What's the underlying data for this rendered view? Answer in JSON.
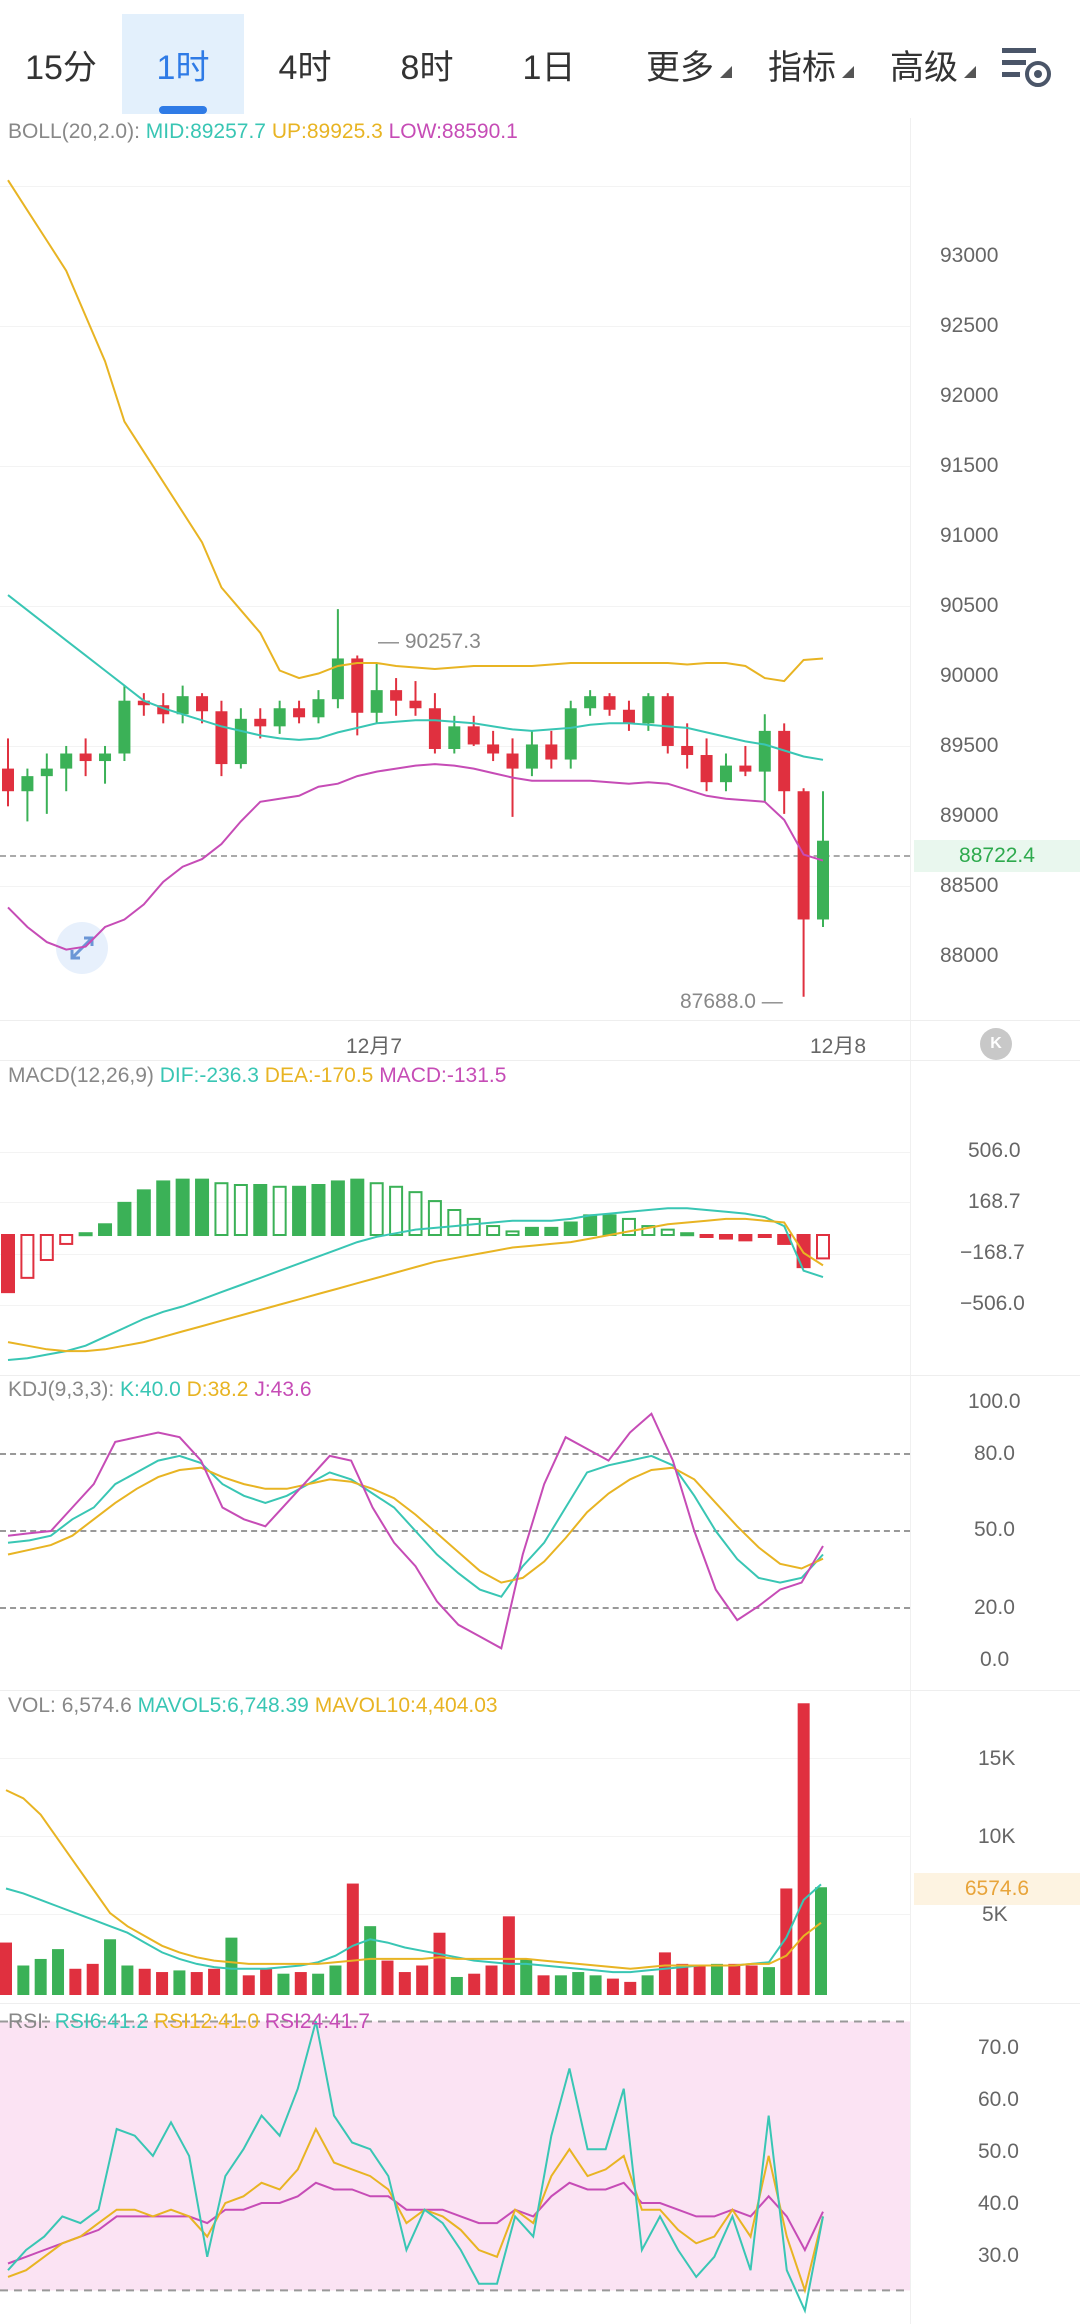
{
  "tabs": [
    {
      "label": "15分",
      "active": false,
      "dropdown": false
    },
    {
      "label": "1时",
      "active": true,
      "dropdown": false
    },
    {
      "label": "4时",
      "active": false,
      "dropdown": false
    },
    {
      "label": "8时",
      "active": false,
      "dropdown": false
    },
    {
      "label": "1日",
      "active": false,
      "dropdown": false
    },
    {
      "label": "更多",
      "active": false,
      "dropdown": true
    },
    {
      "label": "指标",
      "active": false,
      "dropdown": true
    },
    {
      "label": "高级",
      "active": false,
      "dropdown": true
    }
  ],
  "boll": {
    "name": "BOLL(20,2.0):",
    "mid": "MID:89257.7",
    "up": "UP:89925.3",
    "low": "LOW:88590.1"
  },
  "price_ticks": [
    "93000",
    "92500",
    "92000",
    "91500",
    "91000",
    "90500",
    "90000",
    "89500",
    "89000",
    "88500",
    "88000"
  ],
  "current_price": "88722.4",
  "high_label": "90257.3",
  "low_label": "87688.0",
  "dates": [
    "12月7",
    "12月8"
  ],
  "macd": {
    "name": "MACD(12,26,9)",
    "dif": "DIF:-236.3",
    "dea": "DEA:-170.5",
    "macd": "MACD:-131.5",
    "ticks": [
      "506.0",
      "168.7",
      "−168.7",
      "−506.0"
    ]
  },
  "kdj": {
    "name": "KDJ(9,3,3):",
    "k": "K:40.0",
    "d": "D:38.2",
    "j": "J:43.6",
    "ticks": [
      "100.0",
      "80.0",
      "50.0",
      "20.0",
      "0.0"
    ]
  },
  "vol": {
    "name": "VOL:",
    "value": "6,574.6",
    "mavol5": "MAVOL5:6,748.39",
    "mavol10": "MAVOL10:4,404.03",
    "ticks": [
      "15K",
      "10K",
      "5K"
    ],
    "tag": "6574.6"
  },
  "rsi": {
    "name": "RSI:",
    "rsi6": "RSI6:41.2",
    "rsi12": "RSI12:41.0",
    "rsi24": "RSI24:41.7",
    "ticks": [
      "70.0",
      "60.0",
      "50.0",
      "40.0",
      "30.0"
    ]
  },
  "colors": {
    "up": "#3bb157",
    "down": "#e0303f",
    "mid": "#39c6b4",
    "upper": "#e8b423",
    "lower": "#c64cb6",
    "accent": "#2f7be6"
  },
  "chart_data": [
    {
      "type": "candlestick",
      "title": "BOLL(20,2.0)",
      "ylim": [
        87600,
        93300
      ],
      "candles": [
        {
          "o": 89200,
          "h": 89400,
          "l": 88950,
          "c": 89050
        },
        {
          "o": 89050,
          "h": 89200,
          "l": 88850,
          "c": 89150
        },
        {
          "o": 89150,
          "h": 89300,
          "l": 88900,
          "c": 89200
        },
        {
          "o": 89200,
          "h": 89350,
          "l": 89050,
          "c": 89300
        },
        {
          "o": 89300,
          "h": 89400,
          "l": 89150,
          "c": 89250
        },
        {
          "o": 89250,
          "h": 89350,
          "l": 89100,
          "c": 89300
        },
        {
          "o": 89300,
          "h": 89750,
          "l": 89250,
          "c": 89650
        },
        {
          "o": 89650,
          "h": 89700,
          "l": 89550,
          "c": 89620
        },
        {
          "o": 89620,
          "h": 89700,
          "l": 89500,
          "c": 89560
        },
        {
          "o": 89560,
          "h": 89750,
          "l": 89500,
          "c": 89680
        },
        {
          "o": 89680,
          "h": 89700,
          "l": 89500,
          "c": 89580
        },
        {
          "o": 89580,
          "h": 89650,
          "l": 89150,
          "c": 89230
        },
        {
          "o": 89230,
          "h": 89600,
          "l": 89200,
          "c": 89530
        },
        {
          "o": 89530,
          "h": 89600,
          "l": 89400,
          "c": 89480
        },
        {
          "o": 89480,
          "h": 89650,
          "l": 89430,
          "c": 89600
        },
        {
          "o": 89600,
          "h": 89650,
          "l": 89500,
          "c": 89540
        },
        {
          "o": 89540,
          "h": 89720,
          "l": 89500,
          "c": 89660
        },
        {
          "o": 89660,
          "h": 90257,
          "l": 89600,
          "c": 89930
        },
        {
          "o": 89930,
          "h": 89950,
          "l": 89420,
          "c": 89570
        },
        {
          "o": 89570,
          "h": 89900,
          "l": 89500,
          "c": 89720
        },
        {
          "o": 89720,
          "h": 89800,
          "l": 89550,
          "c": 89650
        },
        {
          "o": 89650,
          "h": 89780,
          "l": 89550,
          "c": 89600
        },
        {
          "o": 89600,
          "h": 89700,
          "l": 89300,
          "c": 89330
        },
        {
          "o": 89330,
          "h": 89550,
          "l": 89300,
          "c": 89480
        },
        {
          "o": 89480,
          "h": 89550,
          "l": 89350,
          "c": 89360
        },
        {
          "o": 89360,
          "h": 89450,
          "l": 89250,
          "c": 89300
        },
        {
          "o": 89300,
          "h": 89400,
          "l": 88880,
          "c": 89200
        },
        {
          "o": 89200,
          "h": 89450,
          "l": 89150,
          "c": 89360
        },
        {
          "o": 89360,
          "h": 89450,
          "l": 89200,
          "c": 89260
        },
        {
          "o": 89260,
          "h": 89650,
          "l": 89200,
          "c": 89600
        },
        {
          "o": 89600,
          "h": 89720,
          "l": 89550,
          "c": 89680
        },
        {
          "o": 89680,
          "h": 89700,
          "l": 89550,
          "c": 89590
        },
        {
          "o": 89590,
          "h": 89650,
          "l": 89450,
          "c": 89500
        },
        {
          "o": 89500,
          "h": 89700,
          "l": 89450,
          "c": 89680
        },
        {
          "o": 89680,
          "h": 89700,
          "l": 89300,
          "c": 89350
        },
        {
          "o": 89350,
          "h": 89500,
          "l": 89200,
          "c": 89290
        },
        {
          "o": 89290,
          "h": 89400,
          "l": 89050,
          "c": 89110
        },
        {
          "o": 89110,
          "h": 89300,
          "l": 89050,
          "c": 89220
        },
        {
          "o": 89220,
          "h": 89350,
          "l": 89150,
          "c": 89180
        },
        {
          "o": 89180,
          "h": 89560,
          "l": 88980,
          "c": 89450
        },
        {
          "o": 89450,
          "h": 89500,
          "l": 88900,
          "c": 89050
        },
        {
          "o": 89050,
          "h": 89070,
          "l": 87688,
          "c": 88200
        },
        {
          "o": 88200,
          "h": 89050,
          "l": 88150,
          "c": 88722
        }
      ],
      "lines": {
        "upper": [
          93100,
          92900,
          92700,
          92500,
          92200,
          91900,
          91500,
          91300,
          91100,
          90900,
          90700,
          90400,
          90250,
          90100,
          89850,
          89800,
          89830,
          89880,
          89900,
          89900,
          89880,
          89870,
          89860,
          89870,
          89880,
          89880,
          89880,
          89880,
          89890,
          89900,
          89900,
          89900,
          89900,
          89900,
          89900,
          89890,
          89900,
          89900,
          89880,
          89800,
          89780,
          89920,
          89930
        ],
        "mid": [
          90350,
          90250,
          90150,
          90050,
          89950,
          89850,
          89750,
          89650,
          89600,
          89560,
          89520,
          89480,
          89450,
          89420,
          89400,
          89390,
          89400,
          89440,
          89470,
          89500,
          89510,
          89520,
          89520,
          89510,
          89500,
          89480,
          89460,
          89450,
          89460,
          89470,
          89490,
          89500,
          89500,
          89490,
          89480,
          89470,
          89440,
          89410,
          89380,
          89360,
          89320,
          89280,
          89258
        ],
        "lower": [
          88280,
          88150,
          88050,
          88000,
          88020,
          88150,
          88200,
          88300,
          88450,
          88550,
          88600,
          88700,
          88850,
          88980,
          89000,
          89020,
          89080,
          89100,
          89150,
          89180,
          89200,
          89220,
          89230,
          89220,
          89200,
          89170,
          89140,
          89120,
          89120,
          89120,
          89120,
          89110,
          89100,
          89110,
          89100,
          89060,
          89020,
          89000,
          88990,
          88980,
          88860,
          88630,
          88590
        ]
      }
    },
    {
      "type": "bar",
      "title": "MACD(12,26,9)",
      "ylim": [
        -700,
        700
      ],
      "histogram": [
        -320,
        -240,
        -140,
        -50,
        10,
        60,
        180,
        250,
        300,
        310,
        310,
        290,
        280,
        280,
        270,
        270,
        280,
        300,
        310,
        290,
        270,
        240,
        190,
        140,
        90,
        50,
        20,
        40,
        40,
        70,
        110,
        110,
        90,
        50,
        30,
        10,
        -10,
        -20,
        -30,
        -10,
        -50,
        -180,
        -131
      ],
      "dif": [
        -700,
        -690,
        -670,
        -650,
        -620,
        -570,
        -520,
        -470,
        -430,
        -400,
        -360,
        -320,
        -280,
        -240,
        -200,
        -160,
        -120,
        -80,
        -40,
        -10,
        10,
        30,
        40,
        50,
        60,
        70,
        80,
        80,
        80,
        90,
        110,
        120,
        130,
        140,
        150,
        150,
        140,
        130,
        120,
        100,
        50,
        -200,
        -236
      ],
      "dea": [
        -600,
        -620,
        -640,
        -650,
        -650,
        -640,
        -620,
        -600,
        -570,
        -540,
        -510,
        -480,
        -450,
        -420,
        -390,
        -360,
        -330,
        -300,
        -270,
        -240,
        -210,
        -180,
        -150,
        -130,
        -110,
        -90,
        -70,
        -60,
        -50,
        -40,
        -20,
        0,
        20,
        40,
        60,
        70,
        80,
        90,
        90,
        80,
        70,
        -100,
        -170
      ]
    },
    {
      "type": "line",
      "title": "KDJ(9,3,3)",
      "ylim": [
        -5,
        105
      ],
      "k": [
        45,
        46,
        48,
        55,
        60,
        70,
        75,
        80,
        82,
        79,
        70,
        65,
        62,
        65,
        70,
        75,
        72,
        66,
        60,
        50,
        40,
        32,
        25,
        22,
        35,
        45,
        60,
        75,
        78,
        80,
        82,
        78,
        65,
        50,
        38,
        30,
        28,
        30,
        40
      ],
      "d": [
        40,
        42,
        44,
        48,
        55,
        62,
        68,
        73,
        76,
        77,
        73,
        70,
        68,
        68,
        70,
        72,
        71,
        68,
        64,
        57,
        49,
        41,
        33,
        28,
        30,
        37,
        47,
        58,
        66,
        72,
        76,
        77,
        72,
        62,
        52,
        43,
        36,
        34,
        38.2
      ],
      "j": [
        48,
        49,
        50,
        60,
        70,
        88,
        90,
        92,
        90,
        80,
        60,
        55,
        52,
        62,
        72,
        82,
        80,
        60,
        45,
        35,
        20,
        10,
        5,
        0,
        40,
        70,
        90,
        85,
        80,
        92,
        100,
        80,
        50,
        25,
        12,
        18,
        25,
        28,
        43.6
      ]
    },
    {
      "type": "bar",
      "title": "VOL",
      "ylim": [
        0,
        18000
      ],
      "volumes": [
        3200,
        1800,
        2200,
        2800,
        1600,
        1900,
        3400,
        1800,
        1600,
        1400,
        1500,
        1400,
        1600,
        3500,
        1200,
        1600,
        1300,
        1400,
        1300,
        1800,
        6800,
        4200,
        2100,
        1400,
        1800,
        3800,
        1100,
        1300,
        1800,
        4800,
        2200,
        1200,
        1200,
        1400,
        1200,
        1000,
        800,
        1200,
        2600,
        1900,
        1800,
        1900,
        1900,
        1800,
        1700,
        6500,
        17800,
        6574.6
      ],
      "mavol5": [
        6500,
        6200,
        5800,
        5400,
        5000,
        4600,
        4200,
        3800,
        3200,
        2600,
        2200,
        1900,
        1700,
        1600,
        1600,
        1600,
        1700,
        1800,
        2000,
        2400,
        3000,
        3400,
        3200,
        2900,
        2700,
        2500,
        2300,
        2100,
        2000,
        1900,
        1900,
        1800,
        1700,
        1600,
        1500,
        1400,
        1400,
        1500,
        1600,
        1700,
        1800,
        1800,
        1800,
        1900,
        2000,
        3500,
        5800,
        6748
      ],
      "mavol10": [
        12500,
        12000,
        11000,
        9500,
        8000,
        6500,
        5000,
        4200,
        3600,
        3000,
        2600,
        2300,
        2100,
        2000,
        1900,
        1900,
        1900,
        1900,
        1900,
        2000,
        2100,
        2200,
        2200,
        2200,
        2200,
        2300,
        2200,
        2200,
        2200,
        2200,
        2200,
        2100,
        2000,
        1900,
        1800,
        1700,
        1600,
        1700,
        1800,
        1800,
        1800,
        1800,
        1800,
        1900,
        1900,
        2400,
        3600,
        4404
      ]
    },
    {
      "type": "line",
      "title": "RSI",
      "ylim": [
        25,
        72
      ],
      "rsi6": [
        33,
        36,
        38,
        41,
        40,
        42,
        54,
        53,
        50,
        55,
        50,
        35,
        47,
        51,
        56,
        53,
        60,
        70,
        56,
        52,
        51,
        47,
        36,
        42,
        40,
        36,
        31,
        31,
        41,
        38,
        53,
        63,
        51,
        51,
        60,
        36,
        41,
        36,
        32,
        35,
        41,
        33,
        56,
        33,
        27,
        41
      ],
      "rsi12": [
        32,
        33,
        35,
        37,
        38,
        40,
        42,
        42,
        41,
        42,
        41,
        38,
        43,
        44,
        46,
        45,
        48,
        54,
        49,
        48,
        47,
        45,
        40,
        42,
        41,
        39,
        36,
        35,
        42,
        40,
        47,
        51,
        47,
        48,
        50,
        42,
        42,
        39,
        37,
        38,
        42,
        38,
        50,
        38,
        30,
        41
      ],
      "rsi24": [
        34,
        35,
        36,
        37,
        38,
        39,
        41,
        41,
        41,
        41,
        41,
        40,
        42,
        42,
        43,
        43,
        44,
        46,
        45,
        45,
        44,
        44,
        42,
        42,
        42,
        41,
        40,
        40,
        42,
        41,
        44,
        46,
        45,
        45,
        46,
        43,
        43,
        42,
        41,
        41,
        42,
        41,
        44,
        41,
        36,
        41.7
      ]
    }
  ]
}
